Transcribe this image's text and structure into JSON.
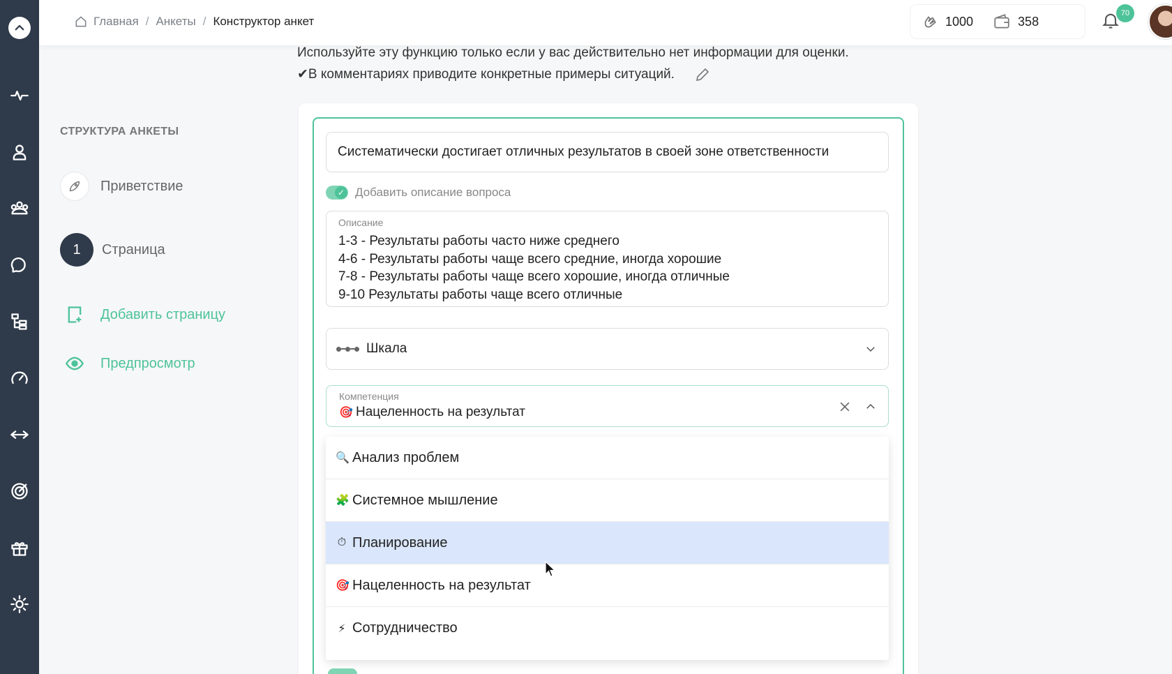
{
  "breadcrumb": {
    "items": [
      "Главная",
      "Анкеты"
    ],
    "separator": "/",
    "current": "Конструктор анкет"
  },
  "counters": {
    "claps": "1000",
    "wallet": "358"
  },
  "notifications": {
    "badge": "70"
  },
  "intro": {
    "line1": "Используйте эту функцию только если у вас действительно нет информации для оценки.",
    "line2": "✔В комментариях приводите конкретные примеры ситуаций."
  },
  "structure": {
    "title": "СТРУКТУРА АНКЕТЫ",
    "welcome": "Приветствие",
    "page_number": "1",
    "page": "Страница",
    "add_page": "Добавить страницу",
    "preview": "Предпросмотр"
  },
  "question": {
    "title": "Систематически достигает отличных результатов в своей зоне ответственности",
    "toggle_label": "Добавить описание вопроса",
    "toggle_on": true,
    "description_label": "Описание",
    "description_lines": [
      "1-3 - Результаты работы часто ниже среднего",
      "4-6 - Результаты работы чаще всего средние, иногда хорошие",
      "7-8 - Результаты работы чаще всего хорошие, иногда отличные",
      "9-10 Результаты работы чаще всего отличные"
    ],
    "type": "Шкала",
    "competency_label": "Компетенция",
    "competency_value": "Нацеленность на результат",
    "competency_icon": "🎯"
  },
  "dropdown": {
    "options": [
      {
        "icon": "🔍",
        "label": "Анализ проблем"
      },
      {
        "icon": "🧩",
        "label": "Системное мышление"
      },
      {
        "icon": "⏱",
        "label": "Планирование"
      },
      {
        "icon": "🎯",
        "label": "Нацеленность на результат"
      },
      {
        "icon": "⚡",
        "label": "Сотрудничество"
      }
    ],
    "highlighted_index": 2
  },
  "colors": {
    "accent": "#4ec39a",
    "rail": "#2f3a4a",
    "highlight": "#d9e6fb"
  }
}
